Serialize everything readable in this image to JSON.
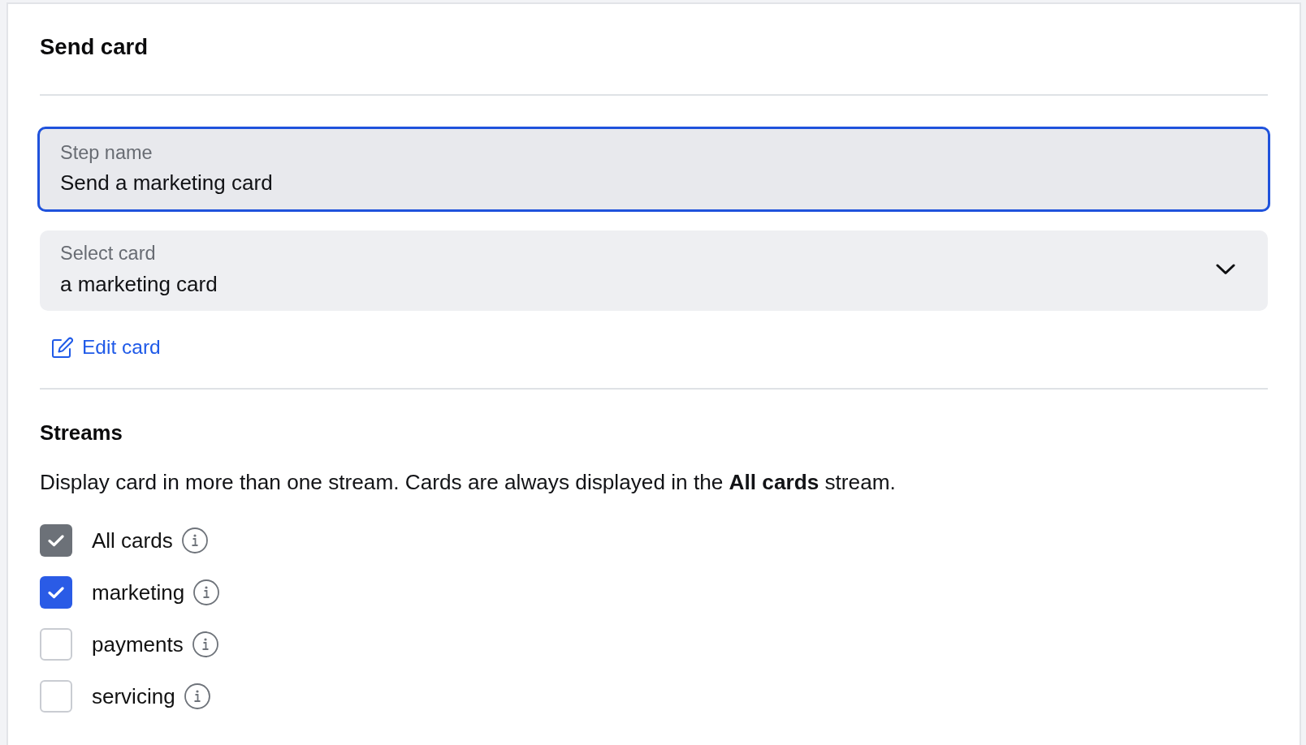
{
  "panel": {
    "title": "Send card"
  },
  "step_name": {
    "label": "Step name",
    "value": "Send a marketing card",
    "focused": true
  },
  "select_card": {
    "label": "Select card",
    "value": "a marketing card"
  },
  "edit_link": {
    "label": "Edit card"
  },
  "streams": {
    "title": "Streams",
    "description": "Display card in more than one stream. Cards are always displayed in the **All cards** stream.",
    "options": [
      {
        "label": "All cards",
        "checked": true,
        "disabled": true
      },
      {
        "label": "marketing",
        "checked": true,
        "disabled": false
      },
      {
        "label": "payments",
        "checked": false,
        "disabled": false
      },
      {
        "label": "servicing",
        "checked": false,
        "disabled": false
      }
    ]
  }
}
